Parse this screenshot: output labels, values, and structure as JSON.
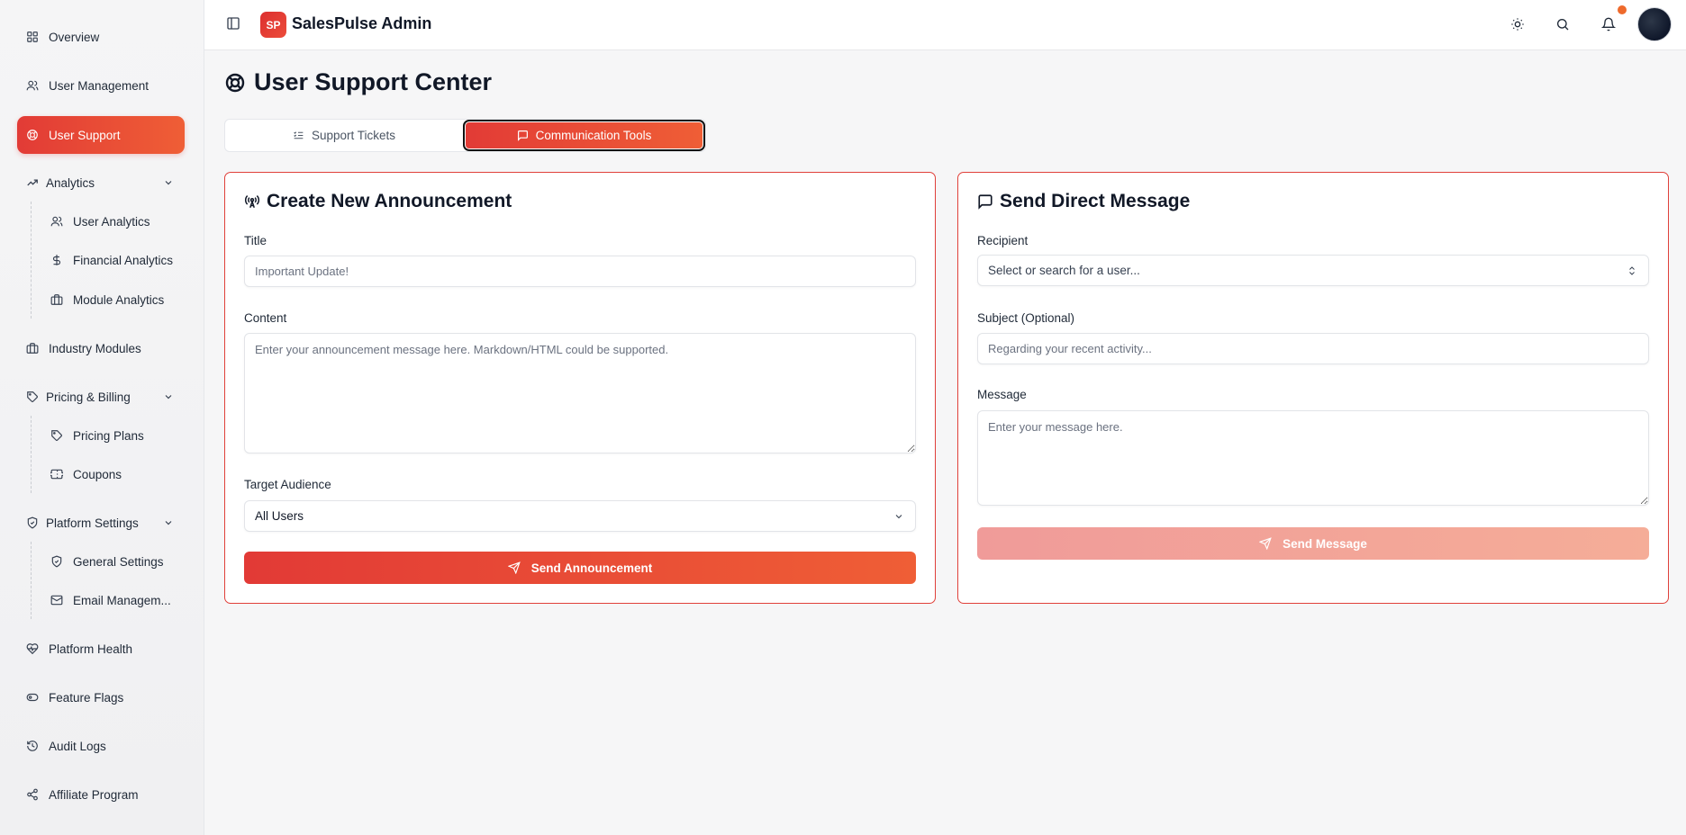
{
  "app": {
    "brand": "SalesPulse Admin",
    "logo_text": "SP"
  },
  "sidebar": {
    "items": [
      {
        "label": "Overview",
        "icon": "grid-icon"
      },
      {
        "label": "User Management",
        "icon": "users-icon"
      },
      {
        "label": "User Support",
        "icon": "lifebuoy-icon",
        "active": true
      },
      {
        "label": "Analytics",
        "icon": "trending-up-icon",
        "group": true
      },
      {
        "label": "User Analytics",
        "icon": "users-icon"
      },
      {
        "label": "Financial Analytics",
        "icon": "dollar-icon"
      },
      {
        "label": "Module Analytics",
        "icon": "briefcase-icon"
      },
      {
        "label": "Industry Modules",
        "icon": "briefcase-icon"
      },
      {
        "label": "Pricing & Billing",
        "icon": "tag-icon",
        "group": true
      },
      {
        "label": "Pricing Plans",
        "icon": "tag-icon"
      },
      {
        "label": "Coupons",
        "icon": "ticket-icon"
      },
      {
        "label": "Platform Settings",
        "icon": "shield-icon",
        "group": true
      },
      {
        "label": "General Settings",
        "icon": "shield-check-icon"
      },
      {
        "label": "Email Managem...",
        "icon": "mail-icon"
      },
      {
        "label": "Platform Health",
        "icon": "heart-pulse-icon"
      },
      {
        "label": "Feature Flags",
        "icon": "toggle-icon"
      },
      {
        "label": "Audit Logs",
        "icon": "history-icon"
      },
      {
        "label": "Affiliate Program",
        "icon": "share-icon"
      }
    ]
  },
  "main": {
    "title": "User Support Center",
    "tabs": [
      {
        "label": "Support Tickets",
        "active": false
      },
      {
        "label": "Communication Tools",
        "active": true
      }
    ],
    "announcement": {
      "title": "Create New Announcement",
      "title_label": "Title",
      "title_placeholder": "Important Update!",
      "content_label": "Content",
      "content_placeholder": "Enter your announcement message here. Markdown/HTML could be supported.",
      "audience_label": "Target Audience",
      "audience_value": "All Users",
      "submit_label": "Send Announcement"
    },
    "direct_message": {
      "title": "Send Direct Message",
      "recipient_label": "Recipient",
      "recipient_placeholder": "Select or search for a user...",
      "subject_label": "Subject (Optional)",
      "subject_placeholder": "Regarding your recent activity...",
      "message_label": "Message",
      "message_placeholder": "Enter your message here.",
      "submit_label": "Send Message",
      "submit_disabled": true
    }
  },
  "colors": {
    "accent_start": "#e23b36",
    "accent_end": "#ef5e36",
    "notification_dot": "#ee6a2c",
    "card_border": "#e0403a"
  }
}
